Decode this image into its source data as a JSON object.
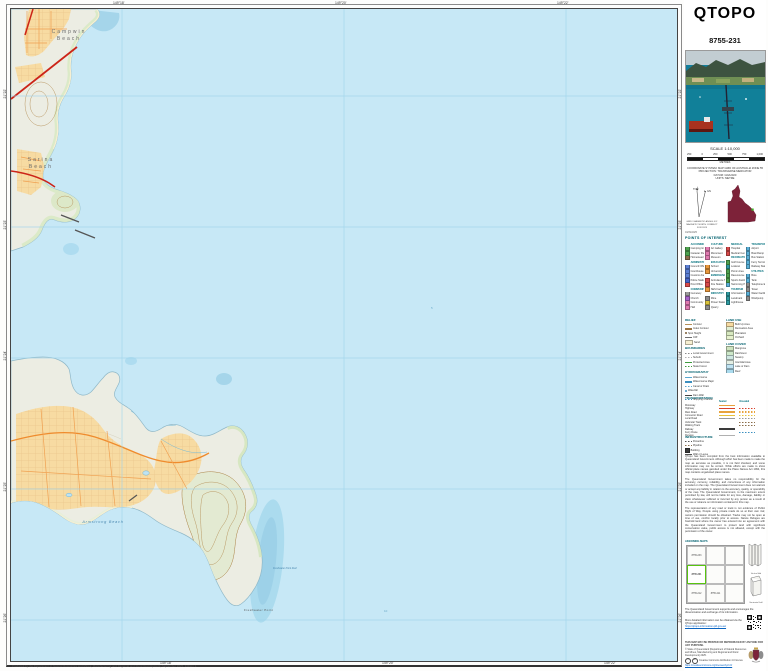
{
  "header": {
    "title": "QTOPO",
    "sheet_number": "8755-231"
  },
  "scale": {
    "label": "SCALE 1:10,000",
    "bar_numbers": [
      "250",
      "0",
      "250",
      "500",
      "750",
      "1,000"
    ],
    "units": "METRES"
  },
  "projection_block": {
    "l1": "COORDINATE SYSTEM: MAP GRID OF AUSTRALIA ZONE 55",
    "l2": "PROJECTION: TRANSVERSE MERCATOR",
    "l3": "DATUM: GDA2020",
    "l4": "UNITS: METRE"
  },
  "declination": {
    "tn": "TN",
    "gn": "GN",
    "cap1": "GRID / MAGNETIC ANGLE 6.9°",
    "cap2": "MAGNETIC NORTH CORRECT FOR 2025"
  },
  "date_line": "04/09/2025",
  "graticule": {
    "top": [
      "149°18'",
      "149°20'",
      "149°22'"
    ],
    "bottom": [
      "149°18'",
      "149°20'",
      "149°22'"
    ],
    "left": [
      "21°22'",
      "21°23'",
      "21°24'",
      "21°25'",
      "21°26'"
    ],
    "right": [
      "21°22'",
      "21°23'",
      "21°24'",
      "21°25'",
      "21°26'"
    ]
  },
  "map_labels": {
    "campwin_1": "Campwin",
    "campwin_2": "Beach",
    "sarina_1": "Sarina",
    "sarina_2": "Beach",
    "armstrong": "Armstrong Beach",
    "freshwater": "Freshwater Point",
    "reef": "Freshwater Point Reef",
    "depth_a": "10",
    "depth_b": "5"
  },
  "legend": {
    "poi_title": "POINTS OF INTEREST",
    "poi_cols": {
      "c0": [
        {
          "h": "ACCOMMODATION"
        },
        {
          "label": "Camping Ground",
          "c": "#4ea24e"
        },
        {
          "label": "Caravan Park",
          "c": "#4ea24e"
        },
        {
          "label": "Homestead",
          "c": "#8a6d4a"
        },
        {
          "h": "ADMINISTRATION"
        },
        {
          "label": "Council Office",
          "c": "#5b7fd4"
        },
        {
          "label": "Courthouse",
          "c": "#5b7fd4"
        },
        {
          "label": "Customs Facility",
          "c": "#5b7fd4"
        },
        {
          "label": "Police Station",
          "c": "#4764c8"
        },
        {
          "label": "Post Office",
          "c": "#d84a4a"
        },
        {
          "h": "COMMUNITY"
        },
        {
          "label": "Cemetery",
          "c": "#9a9a9a"
        },
        {
          "label": "Church",
          "c": "#a763c8"
        },
        {
          "label": "Community Centre",
          "c": "#e07ab0"
        },
        {
          "label": "Hall",
          "c": "#e07ab0"
        }
      ],
      "c1": [
        {
          "h": "CULTURE"
        },
        {
          "label": "Art Gallery",
          "c": "#e07ab0"
        },
        {
          "label": "Monument",
          "c": "#e07ab0"
        },
        {
          "label": "Museum",
          "c": "#e07ab0"
        },
        {
          "h": "EDUCATION"
        },
        {
          "label": "School",
          "c": "#e8973c"
        },
        {
          "label": "University",
          "c": "#e8973c"
        },
        {
          "h": "EMERGENCY"
        },
        {
          "label": "Ambulance Station",
          "c": "#d84a4a"
        },
        {
          "label": "Fire Station",
          "c": "#d84a4a"
        },
        {
          "label": "SES Facility",
          "c": "#e8973c"
        },
        {
          "h": "INDUSTRY"
        },
        {
          "label": "Mine",
          "c": "#8c8c8c"
        },
        {
          "label": "Power Station",
          "c": "#d8c23c"
        },
        {
          "label": "Quarry",
          "c": "#8c8c8c"
        }
      ],
      "c2": [
        {
          "h": "MEDICAL"
        },
        {
          "label": "Hospital",
          "c": "#d84a4a"
        },
        {
          "label": "Medical Centre",
          "c": "#d84a4a"
        },
        {
          "h": "RECREATION"
        },
        {
          "label": "Golf Course",
          "c": "#4ea24e"
        },
        {
          "label": "Lookout",
          "c": "#2d9aa0"
        },
        {
          "label": "Picnic Area",
          "c": "#4ea24e"
        },
        {
          "label": "Racecourse",
          "c": "#4ea24e"
        },
        {
          "label": "Sports Facility",
          "c": "#4ea24e"
        },
        {
          "label": "Swimming Pool",
          "c": "#59b0d8"
        },
        {
          "h": "TOURISM"
        },
        {
          "label": "Information Centre",
          "c": "#2d9aa0"
        },
        {
          "label": "Landmark",
          "c": "#2d9aa0"
        },
        {
          "label": "Lighthouse",
          "c": "#2d9aa0"
        }
      ],
      "c3": [
        {
          "h": "TRANSPORT"
        },
        {
          "label": "Airport",
          "c": "#59b0d8"
        },
        {
          "label": "Boat Ramp",
          "c": "#59b0d8"
        },
        {
          "label": "Bus Station",
          "c": "#59b0d8"
        },
        {
          "label": "Ferry Terminal",
          "c": "#59b0d8"
        },
        {
          "label": "Railway Station",
          "c": "#59b0d8"
        },
        {
          "h": "UTILITIES"
        },
        {
          "label": "Bore",
          "c": "#59b0d8"
        },
        {
          "label": "Tank",
          "c": "#59b0d8"
        },
        {
          "label": "Telephone Exchange",
          "c": "#8c8c8c"
        },
        {
          "label": "Tower",
          "c": "#8c8c8c"
        },
        {
          "label": "Water Facility",
          "c": "#59b0d8"
        },
        {
          "label": "Windpump",
          "c": "#8c8c8c"
        }
      ]
    },
    "groups": {
      "relief": {
        "title": "RELIEF",
        "items": [
          {
            "label": "Contour",
            "k": "ln",
            "c": "#b5915a"
          },
          {
            "label": "Index Contour",
            "k": "ln2",
            "c": "#9a7340"
          },
          {
            "label": "Spot Height",
            "k": "dot",
            "c": "#7a5c34"
          },
          {
            "label": "Cliff",
            "k": "ln",
            "c": "#6e6e6e"
          },
          {
            "label": "Sand",
            "k": "sw",
            "c": "#f6efd2"
          }
        ]
      },
      "boundaries": {
        "title": "BOUNDARIES",
        "items": [
          {
            "label": "Local Government",
            "k": "dash",
            "c": "#8c8c8c"
          },
          {
            "label": "Suburb",
            "k": "dash",
            "c": "#b0b0b0"
          },
          {
            "label": "Protected Area",
            "k": "ln",
            "c": "#3d9c3d"
          },
          {
            "label": "State Forest",
            "k": "dash",
            "c": "#3d9c3d"
          }
        ]
      },
      "hydro": {
        "title": "HYDROGRAPHY",
        "items": [
          {
            "label": "Watercourse",
            "k": "ln",
            "c": "#59a8d0"
          },
          {
            "label": "Watercourse Major",
            "k": "ln2",
            "c": "#3c90c0"
          },
          {
            "label": "Canal or Drain",
            "k": "dash",
            "c": "#59a8d0"
          },
          {
            "label": "Waterfall",
            "k": "dot",
            "c": "#3c90c0"
          },
          {
            "label": "Dam Wall",
            "k": "ln",
            "c": "#444444"
          },
          {
            "label": "Shipping Channel",
            "k": "dash",
            "c": "#3c90c0"
          }
        ]
      },
      "landuse": {
        "title": "LAND USE",
        "items": [
          {
            "label": "Built Up Area",
            "k": "sw",
            "c": "#f7dba2"
          },
          {
            "label": "Recreation Area",
            "k": "sw",
            "c": "#e2efd4"
          },
          {
            "label": "Plantation",
            "k": "sw",
            "c": "#d7e8bf"
          },
          {
            "label": "Orchard",
            "k": "sw",
            "c": "#e6f1cd"
          }
        ]
      },
      "landcover": {
        "title": "LAND COVER",
        "items": [
          {
            "label": "Mangrove",
            "k": "sw",
            "c": "#cfe4c0"
          },
          {
            "label": "Rainforest",
            "k": "sw",
            "c": "#cde8c9"
          },
          {
            "label": "Swamp",
            "k": "sw",
            "c": "#cfe8e2"
          },
          {
            "label": "Intertidal Area",
            "k": "sw",
            "c": "#e4efe4"
          },
          {
            "label": "Lake or Dam",
            "k": "sw",
            "c": "#bfe3f2"
          },
          {
            "label": "Reef",
            "k": "sw",
            "c": "#abdbee"
          }
        ]
      }
    },
    "transport": {
      "title": "TRANSPORTATION",
      "sub1": "Sealed",
      "sub2": "Unsealed",
      "rows": [
        {
          "label": "Motorway",
          "s1": {
            "c": "#e8a33c"
          },
          "s2": null
        },
        {
          "label": "Highway",
          "s1": {
            "c": "#d8402a"
          },
          "s2": {
            "c": "#d8402a",
            "d": 1
          }
        },
        {
          "label": "Main Road",
          "s1": {
            "c": "#e8a33c"
          },
          "s2": {
            "c": "#e8a33c",
            "d": 1
          }
        },
        {
          "label": "Connector Road",
          "s1": {
            "c": "#e8c23c"
          },
          "s2": {
            "c": "#e8c23c",
            "d": 1
          }
        },
        {
          "label": "Local Road",
          "s1": {
            "c": "#9a9a9a"
          },
          "s2": {
            "c": "#9a9a9a",
            "d": 1
          }
        },
        {
          "label": "Vehicular Track",
          "s1": null,
          "s2": {
            "c": "#8a6d4a",
            "d": 1
          }
        },
        {
          "label": "Walking Track",
          "s1": null,
          "s2": {
            "c": "#8a6d4a",
            "d": 1
          }
        },
        {
          "label": "Railway",
          "s1": {
            "c": "#3a3a3a"
          },
          "s2": null
        },
        {
          "label": "Ferry Route",
          "s1": null,
          "s2": {
            "c": "#3c90c0",
            "d": 1
          }
        },
        {
          "label": "Runway",
          "s1": {
            "c": "#b0b0b0"
          },
          "s2": null
        }
      ]
    },
    "infrastructure": {
      "title": "INFRASTRUCTURE",
      "items": [
        {
          "label": "Powerline",
          "k": "dash",
          "c": "#555555"
        },
        {
          "label": "Pipeline",
          "k": "dash",
          "c": "#8a6d4a"
        },
        {
          "label": "Building",
          "k": "sq",
          "c": "#3a3a3a"
        },
        {
          "label": "Wall or Levee",
          "k": "ln",
          "c": "#555555"
        }
      ]
    }
  },
  "disclaimer": {
    "p1": "QTopo has been compiled from the best information available to Queensland Government. Although effort has been made to make the map as accurate as possible, it is not field checked, and some information may not be correct. While efforts are made to show official place names gazetted under the Place Names Act 1994, this map contains ungazetted place names.",
    "p2": "The Queensland Government takes no responsibility for the accuracy, currency, reliability, and correctness of any information included on the map. The Queensland Government does not warrant or accept any liability in relation to the accuracy, quality, or operability of the map. The Queensland Government, to the maximum extent permitted by law, will not be liable for any loss, damage, liability or claim whatsoever suffered or incurred by any person as a result of the use or reliance on information contained in this map.",
    "p3": "The representation of any road or track is not evidence of Public Right of Way. People using private roads do so at their own risk; owners permission should be obtained. Tracks may not be open at time of use, confirm locally prior to access. Nature Refuges are freehold land where the owner has entered into an agreement with the Queensland Government to protect land with significant conservation value, public access is not allowed, except with the permission of the owner."
  },
  "adjoining": {
    "title": "ADJOINING MAPS",
    "cells": [
      {
        "label": "8755-233"
      },
      {},
      {},
      {
        "label": "8755-231",
        "cur": 1
      },
      {},
      {},
      {
        "label": "8755-212"
      },
      {
        "label": "8755-211"
      },
      {}
    ],
    "fold1": "Vertical fold",
    "fold2": "Horizontal fold"
  },
  "footer": {
    "dissemination": "The Queensland Government supports and encourages the dissemination and exchange of its information.",
    "app_line": "More detailed information can be obtained via the QTopo application:",
    "app_url": "https://qtopo.information.qld.gov.au/",
    "print_notice": "THIS MAP MAY BE PRINTED OR REPRODUCED BY ANYONE FOR ANY PURPOSE.",
    "copyright": "© State of Queensland (Department of Natural Resources and Mines, Manufacturing and Regional and Rural Development) 2025.",
    "cc_line": "Creative Commons Attribution 4.0 licence",
    "cc_url": "https://creativecommons.org/licenses/by/4.0/",
    "produced": "Produced by the Department of Natural Resources and Mines, Manufacturing and Regional and Rural Development, September 2025. Edition 1."
  },
  "colors": {
    "sea": "#c7e8f6",
    "land": "#ecede3",
    "town": "#f7dba2",
    "reef": "#a5d5ea",
    "road_red": "#cc2418",
    "road_orange": "#ef8b2d",
    "accent_teal": "#00606e",
    "qld_maroon": "#7d2239",
    "highlight_green": "#58c410"
  }
}
